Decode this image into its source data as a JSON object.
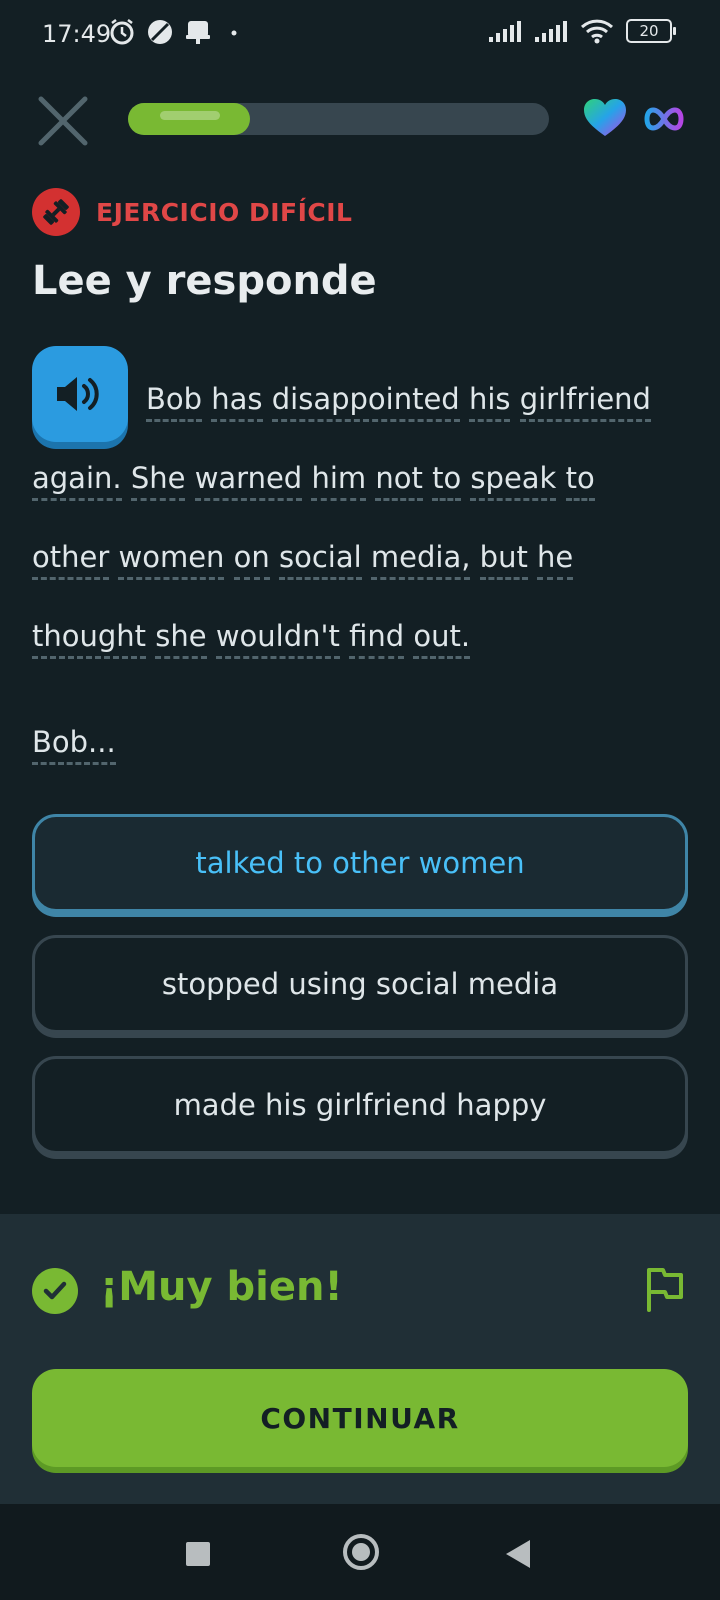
{
  "status_bar": {
    "time": "17:49",
    "battery": "20",
    "left_icons": [
      "alarm-icon",
      "leaf-icon",
      "notification-icon",
      "dot-icon"
    ],
    "right_icons": [
      "signal-icon",
      "signal-icon",
      "wifi-icon",
      "battery-icon"
    ]
  },
  "header": {
    "progress": 0.29,
    "icons": [
      "close-icon",
      "heart-icon",
      "infinity-icon"
    ]
  },
  "exercise": {
    "badge": "EJERCICIO DIFÍCIL",
    "title": "Lee y responde",
    "passage_words": [
      [
        "Bob",
        "has",
        "disappointed",
        "his",
        "girlfriend"
      ],
      [
        "again.",
        "She",
        "warned",
        "him",
        "not",
        "to",
        "speak",
        "to"
      ],
      [
        "other",
        "women",
        "on",
        "social",
        "media,",
        "but",
        "he"
      ],
      [
        "thought",
        "she",
        "wouldn't",
        "find",
        "out."
      ]
    ],
    "prompt": "Bob..."
  },
  "options": [
    {
      "label": "talked to other women",
      "selected": true
    },
    {
      "label": "stopped using social media",
      "selected": false
    },
    {
      "label": "made his girlfriend happy",
      "selected": false
    }
  ],
  "feedback": {
    "message": "¡Muy bien!",
    "continue_label": "CONTINUAR"
  },
  "colors": {
    "background": "#131f24",
    "accent_green": "#79b933",
    "accent_blue": "#49c0f8",
    "hard_red": "#d33131"
  }
}
